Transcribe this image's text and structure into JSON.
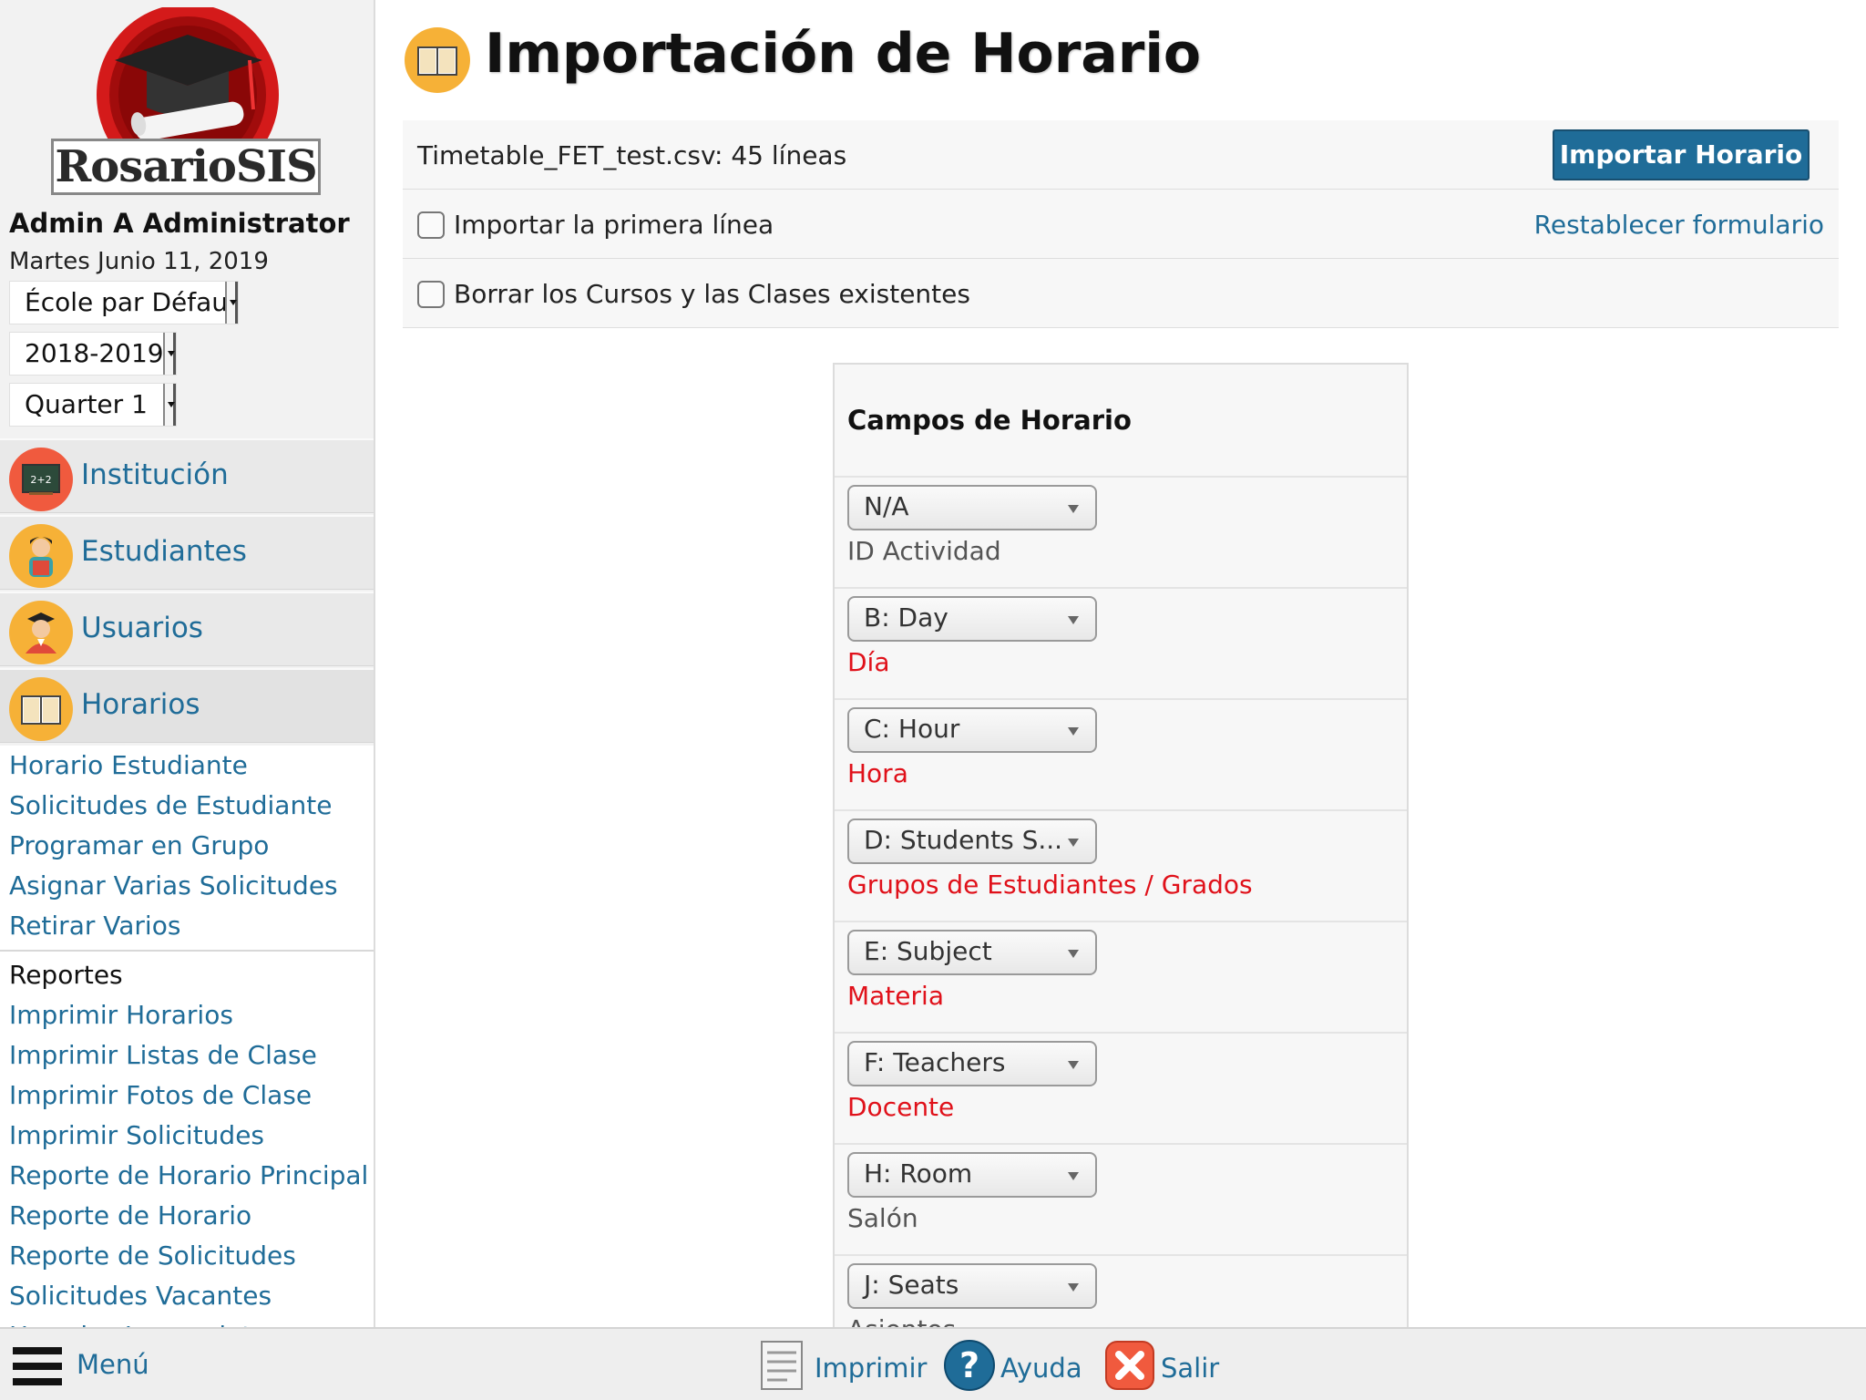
{
  "sidebar": {
    "logo_text": "RosarioSIS",
    "user_name": "Admin A Administrator",
    "date": "Martes Junio 11, 2019",
    "school_select": "École par Défaut",
    "year_select": "2018-2019",
    "period_select": "Quarter 1",
    "modules": [
      {
        "label": "Institución",
        "icon": "school-board-icon"
      },
      {
        "label": "Estudiantes",
        "icon": "student-icon"
      },
      {
        "label": "Usuarios",
        "icon": "user-graduate-icon"
      },
      {
        "label": "Horarios",
        "icon": "book-icon"
      }
    ],
    "submenu": [
      "Horario Estudiante",
      "Solicitudes de Estudiante",
      "Programar en Grupo",
      "Asignar Varias Solicitudes",
      "Retirar Varios"
    ],
    "reports_heading": "Reportes",
    "reports": [
      "Imprimir Horarios",
      "Imprimir Listas de Clase",
      "Imprimir Fotos de Clase",
      "Imprimir Solicitudes",
      "Reporte de Horario Principal",
      "Reporte de Horario",
      "Reporte de Solicitudes",
      "Solicitudes Vacantes",
      "Horarios Incompletos"
    ]
  },
  "main": {
    "title": "Importación de Horario",
    "title_icon": "book-icon",
    "file_info": "Timetable_FET_test.csv: 45 líneas",
    "import_button": "Importar Horario",
    "import_first_line": "Importar la primera línea",
    "reset_form": "Restablecer formulario",
    "delete_existing": "Borrar los Cursos y las Clases existentes",
    "fields_title": "Campos de Horario",
    "fields": [
      {
        "select": "N/A",
        "label": "ID Actividad",
        "required": false
      },
      {
        "select": "B: Day",
        "label": "Día",
        "required": true
      },
      {
        "select": "C: Hour",
        "label": "Hora",
        "required": true
      },
      {
        "select": "D: Students S...",
        "label": "Grupos de Estudiantes / Grados",
        "required": true
      },
      {
        "select": "E: Subject",
        "label": "Materia",
        "required": true
      },
      {
        "select": "F: Teachers",
        "label": "Docente",
        "required": true
      },
      {
        "select": "H: Room",
        "label": "Salón",
        "required": false
      },
      {
        "select": "J: Seats",
        "label": "Asientos",
        "required": false
      }
    ]
  },
  "footer": {
    "menu": "Menú",
    "print": "Imprimir",
    "help": "Ayuda",
    "logout": "Salir"
  },
  "colors": {
    "link": "#1f6c98",
    "required": "#e0111a",
    "icon_orange": "#f6b137",
    "icon_red": "#f05a3e"
  }
}
